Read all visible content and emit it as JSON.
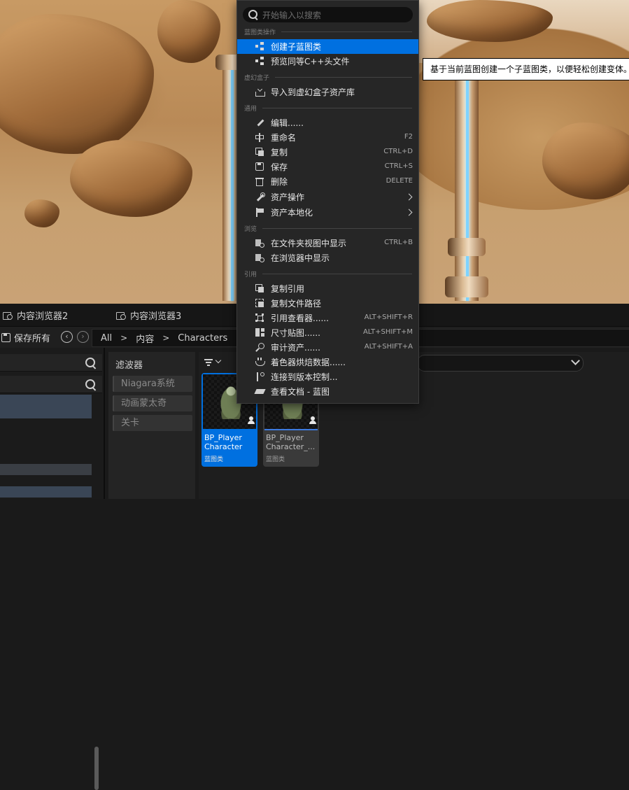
{
  "tabs": [
    {
      "label": "内容浏览器2"
    },
    {
      "label": "内容浏览器3"
    }
  ],
  "toolbar": {
    "save_all": "保存所有",
    "back_icon": "back-arrow-icon",
    "forward_icon": "forward-arrow-icon",
    "breadcrumb": [
      "All",
      "内容",
      "Characters"
    ]
  },
  "filters": {
    "title": "滤波器",
    "chips": [
      "Niagara系统",
      "动画蒙太奇",
      "关卡"
    ]
  },
  "assets": [
    {
      "name": "BP_Player Character",
      "type": "蓝图类",
      "selected": true
    },
    {
      "name": "BP_Player Character_...",
      "type": "蓝图类",
      "selected": false
    }
  ],
  "menu": {
    "search_placeholder": "开始输入以搜索",
    "sections": {
      "blueprint": "蓝图类操作",
      "unreal": "虚幻盒子",
      "common": "通用",
      "browse": "浏览",
      "reference": "引用"
    },
    "items": {
      "create_child": "创建子蓝图类",
      "preview_cpp": "预览同等C++头文件",
      "import_box": "导入到虚幻盒子资产库",
      "edit": "编辑......",
      "rename": "重命名",
      "rename_sc": "F2",
      "copy": "复制",
      "copy_sc": "CTRL+D",
      "save": "保存",
      "save_sc": "CTRL+S",
      "delete": "删除",
      "delete_sc": "DELETE",
      "asset_actions": "资产操作",
      "asset_localize": "资产本地化",
      "show_in_folder": "在文件夹视图中显示",
      "show_in_folder_sc": "CTRL+B",
      "show_in_browser": "在浏览器中显示",
      "copy_reference": "复制引用",
      "copy_file_path": "复制文件路径",
      "reference_viewer": "引用查看器......",
      "reference_viewer_sc": "ALT+SHIFT+R",
      "size_map": "尺寸贴图......",
      "size_map_sc": "ALT+SHIFT+M",
      "audit_assets": "审计资产......",
      "audit_assets_sc": "ALT+SHIFT+A",
      "shader_cook": "着色器烘焙数据......",
      "source_control": "连接到版本控制...",
      "view_docs": "查看文档 - 蓝图"
    }
  },
  "tooltip": "基于当前蓝图创建一个子蓝图类，以便轻松创建变体。",
  "colors": {
    "highlight": "#0070e0",
    "selected_tile": "#0070e0",
    "menu_bg": "#262626"
  }
}
